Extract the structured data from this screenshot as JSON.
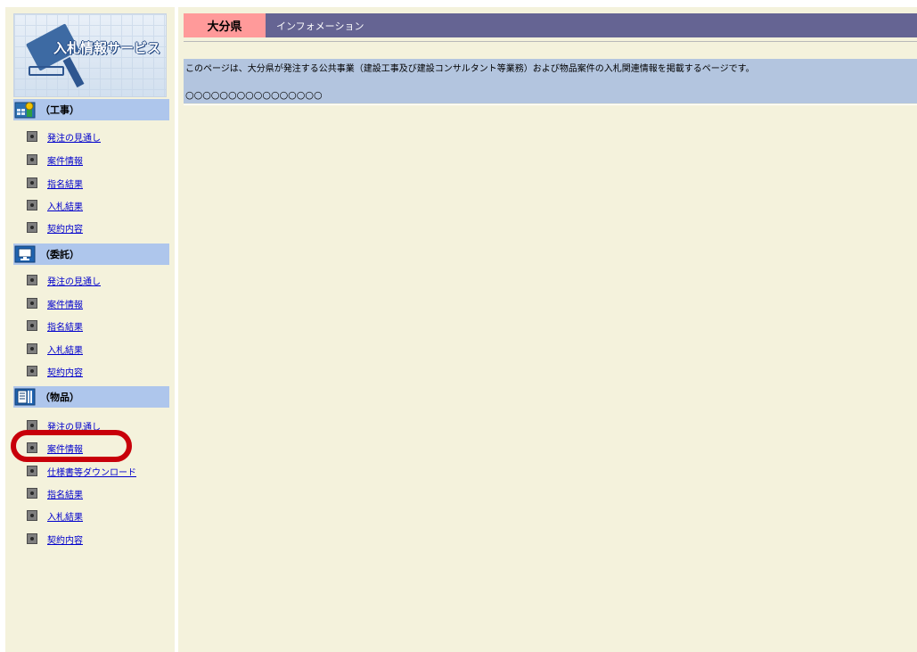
{
  "logo": {
    "text": "入札情報サービス"
  },
  "header": {
    "prefecture": "大分県",
    "section": "インフォメーション"
  },
  "content": {
    "description": "このページは、大分県が発注する公共事業（建設工事及び建設コンサルタント等業務）および物品案件の入札関連情報を掲載するページです。",
    "placeholder": "○○○○○○○○○○○○○○○○"
  },
  "sidebar": {
    "construction": {
      "label": "（工事）",
      "icon": "construction-icon",
      "items": [
        "発注の見通し",
        "案件情報",
        "指名結果",
        "入札結果",
        "契約内容"
      ]
    },
    "consulting": {
      "label": "（委託）",
      "icon": "monitor-icon",
      "items": [
        "発注の見通し",
        "案件情報",
        "指名結果",
        "入札結果",
        "契約内容"
      ]
    },
    "goods": {
      "label": "（物品）",
      "icon": "documents-icon",
      "items": [
        "発注の見通し",
        "案件情報",
        "仕様書等ダウンロード",
        "指名結果",
        "入札結果",
        "契約内容"
      ]
    }
  },
  "colors": {
    "header_bg": "#656493",
    "prefecture_tab": "#ff9a9a",
    "section_header": "#aec6ec",
    "content_band": "#b3c5df",
    "page_bg": "#f4f2dc",
    "link": "#0000cc",
    "highlight": "#c8000a"
  }
}
